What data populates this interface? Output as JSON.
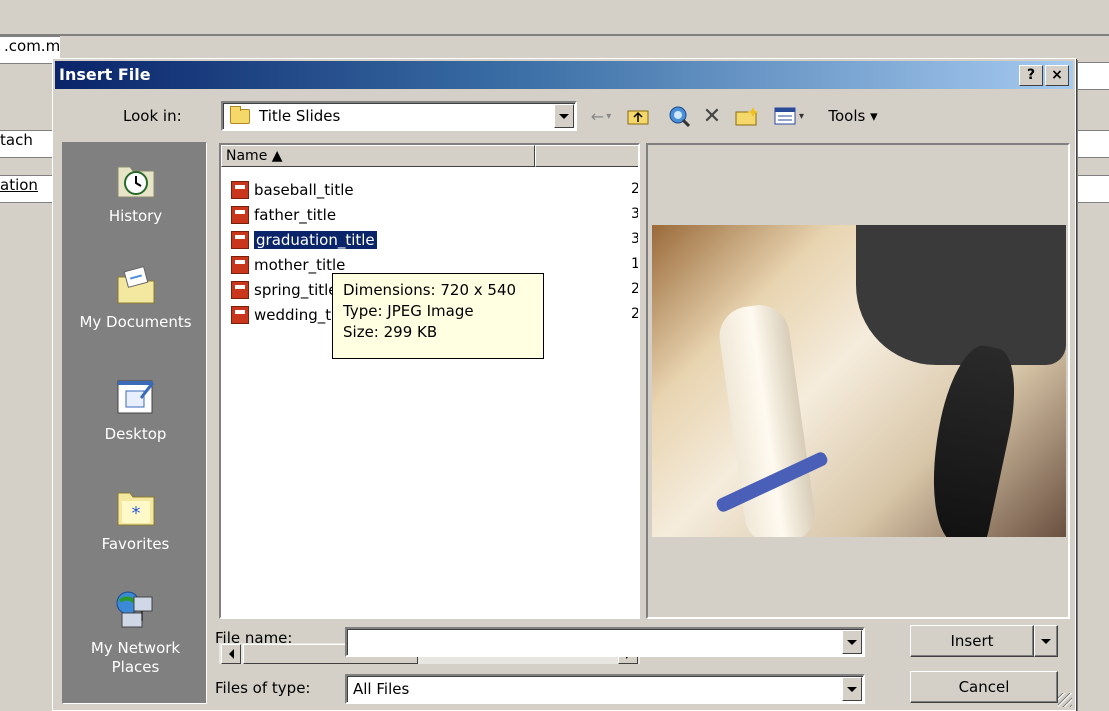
{
  "background": {
    "row1": ".com.my:",
    "row2": "tach",
    "row3": "ation"
  },
  "dialog": {
    "title": "Insert File",
    "help_button": "?",
    "close_button": "×",
    "look_in_label": "Look in:",
    "look_in_value": "Title Slides",
    "toolbar": {
      "back": "←",
      "up_folder": "up-folder-icon",
      "search_web": "search-web-icon",
      "delete": "✕",
      "new_folder": "new-folder-icon",
      "views": "views-icon",
      "tools_label": "Tools ▾"
    },
    "places": [
      {
        "label": "History",
        "icon": "history-icon"
      },
      {
        "label": "My Documents",
        "icon": "my-documents-icon"
      },
      {
        "label": "Desktop",
        "icon": "desktop-icon"
      },
      {
        "label": "Favorites",
        "icon": "favorites-icon"
      },
      {
        "label": "My Network\nPlaces",
        "icon": "network-places-icon"
      }
    ],
    "file_list": {
      "column_name": "Name ▲",
      "files": [
        {
          "name": "baseball_title",
          "size": "2"
        },
        {
          "name": "father_title",
          "size": "3"
        },
        {
          "name": "graduation_title",
          "size": "3",
          "selected": true
        },
        {
          "name": "mother_title",
          "size": "1"
        },
        {
          "name": "spring_title",
          "size": "2"
        },
        {
          "name": "wedding_title",
          "size": "2"
        }
      ]
    },
    "tooltip": {
      "dimensions": "Dimensions: 720 x 540",
      "type": "Type: JPEG Image",
      "size": "Size: 299 KB"
    },
    "file_name_label": "File name:",
    "file_name_value": "",
    "files_of_type_label": "Files of type:",
    "files_of_type_value": "All Files",
    "insert_button": "Insert",
    "cancel_button": "Cancel"
  },
  "colors": {
    "title_bar_start": "#0a246a",
    "selection": "#0a246a",
    "tooltip_bg": "#ffffe1",
    "dialog_bg": "#d4d0c8"
  }
}
